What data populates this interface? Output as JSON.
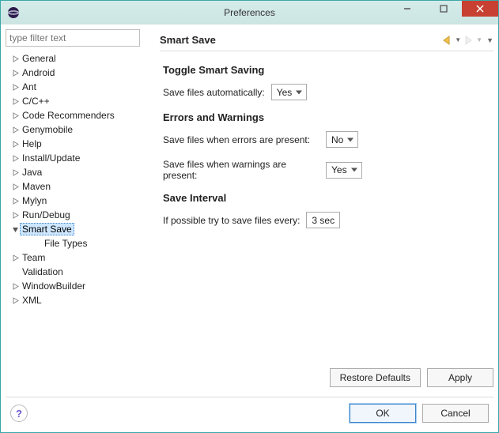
{
  "window": {
    "title": "Preferences"
  },
  "filter": {
    "placeholder": "type filter text"
  },
  "tree": {
    "items": [
      {
        "label": "General",
        "expandable": true
      },
      {
        "label": "Android",
        "expandable": true
      },
      {
        "label": "Ant",
        "expandable": true
      },
      {
        "label": "C/C++",
        "expandable": true
      },
      {
        "label": "Code Recommenders",
        "expandable": true
      },
      {
        "label": "Genymobile",
        "expandable": true
      },
      {
        "label": "Help",
        "expandable": true
      },
      {
        "label": "Install/Update",
        "expandable": true
      },
      {
        "label": "Java",
        "expandable": true
      },
      {
        "label": "Maven",
        "expandable": true
      },
      {
        "label": "Mylyn",
        "expandable": true
      },
      {
        "label": "Run/Debug",
        "expandable": true
      },
      {
        "label": "Smart Save",
        "expandable": true,
        "expanded": true,
        "selected": true,
        "children": [
          {
            "label": "File Types"
          }
        ]
      },
      {
        "label": "Team",
        "expandable": true
      },
      {
        "label": "Validation",
        "expandable": false
      },
      {
        "label": "WindowBuilder",
        "expandable": true
      },
      {
        "label": "XML",
        "expandable": true
      }
    ]
  },
  "page": {
    "title": "Smart Save",
    "sections": {
      "toggle": {
        "heading": "Toggle Smart Saving",
        "save_auto_label": "Save files automatically:",
        "save_auto_value": "Yes"
      },
      "errors": {
        "heading": "Errors and Warnings",
        "errors_label": "Save files when errors are present:",
        "errors_value": "No",
        "warnings_label": "Save files when warnings are present:",
        "warnings_value": "Yes"
      },
      "interval": {
        "heading": "Save Interval",
        "interval_label": "If possible try to save files every:",
        "interval_value": "3 sec"
      }
    },
    "buttons": {
      "restore": "Restore Defaults",
      "apply": "Apply"
    }
  },
  "dialog_buttons": {
    "ok": "OK",
    "cancel": "Cancel"
  }
}
